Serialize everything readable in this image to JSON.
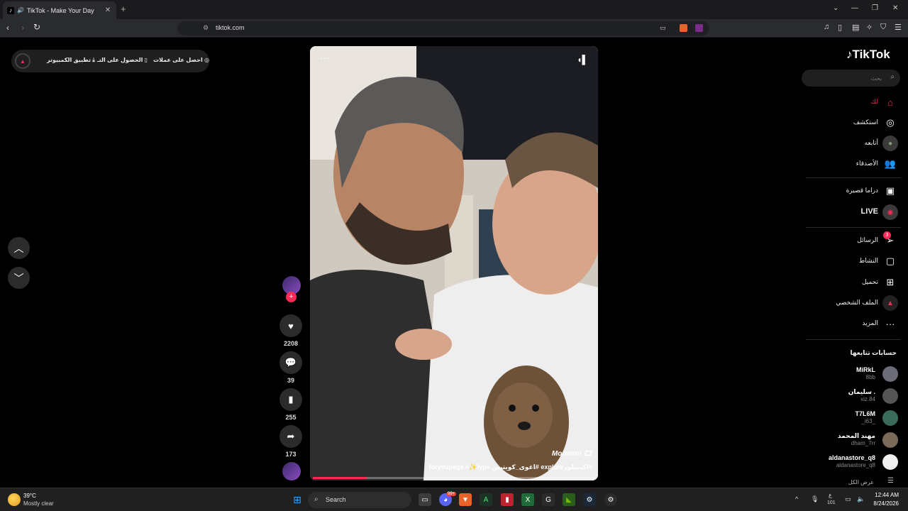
{
  "browser": {
    "tab_title": "TikTok - Make Your Day",
    "new_tab": "+",
    "url": "tiktok.com",
    "window_controls": [
      "⌄",
      "—",
      "❐",
      "✕"
    ]
  },
  "topbar": {
    "offer_label": "احصل على عملات",
    "app_label": "الحصول على التـ",
    "desktop_label": "تطبيق الكمبيوتر"
  },
  "video": {
    "progress_fraction": 0.19,
    "author": "Monmon 🎞",
    "caption": "#اكسبلورexplore #اغوى_كويتيين #foryoupage #✨fyp"
  },
  "actions": {
    "likes": "2208",
    "comments": "39",
    "bookmarks": "255",
    "shares": "173"
  },
  "sidebar": {
    "brand": "TikTok",
    "search_placeholder": "بحث",
    "nav": [
      {
        "label": "لك",
        "icon": "home-icon",
        "glyph": "⌂",
        "color": "#fe2c55"
      },
      {
        "label": "استكشف",
        "icon": "compass-icon",
        "glyph": "◎",
        "color": "#ffffff"
      },
      {
        "label": "أتابعه",
        "icon": "following-avatar-icon",
        "glyph": "●",
        "color": "#7ea070"
      },
      {
        "label": "الأصدقاء",
        "icon": "friends-icon",
        "glyph": "👥",
        "color": "#ffffff"
      },
      {
        "label": "دراما قصيرة",
        "icon": "film-icon",
        "glyph": "▣",
        "color": "#ffffff"
      },
      {
        "label": "LIVE",
        "icon": "live-icon",
        "glyph": "◉",
        "color": "#fe2c55"
      },
      {
        "label": "الرسائل",
        "icon": "send-icon",
        "glyph": "➢",
        "color": "#ffffff",
        "badge": "3"
      },
      {
        "label": "النشاط",
        "icon": "activity-icon",
        "glyph": "▢",
        "color": "#ffffff"
      },
      {
        "label": "تحميل",
        "icon": "upload-icon",
        "glyph": "⊞",
        "color": "#ffffff"
      },
      {
        "label": "الملف الشخصي",
        "icon": "profile-icon",
        "glyph": "▲",
        "color": "#fe2c55"
      },
      {
        "label": "المزيد",
        "icon": "more-icon",
        "glyph": "···",
        "color": "#ffffff"
      }
    ],
    "following_header": "حسابات تتابعها",
    "following": [
      {
        "name": "MiRkL",
        "handle": "8bb"
      },
      {
        "name": "سليمان .",
        "handle": "xiz.84"
      },
      {
        "name": "T7L6M",
        "handle": "_i63_"
      },
      {
        "name": "مهند المحمد",
        "handle": "dham_7rr"
      },
      {
        "name": "aldanastore_q8",
        "handle": "aldanastore_q8"
      }
    ],
    "see_all": "عرض الكل"
  },
  "taskbar": {
    "temperature": "39°C",
    "condition": "Mostly clear",
    "search_label": "Search",
    "notif_badge": "99+",
    "lang": "ع",
    "lang_sub": "101",
    "time": "12:44 AM",
    "date": "8/24/2026"
  }
}
